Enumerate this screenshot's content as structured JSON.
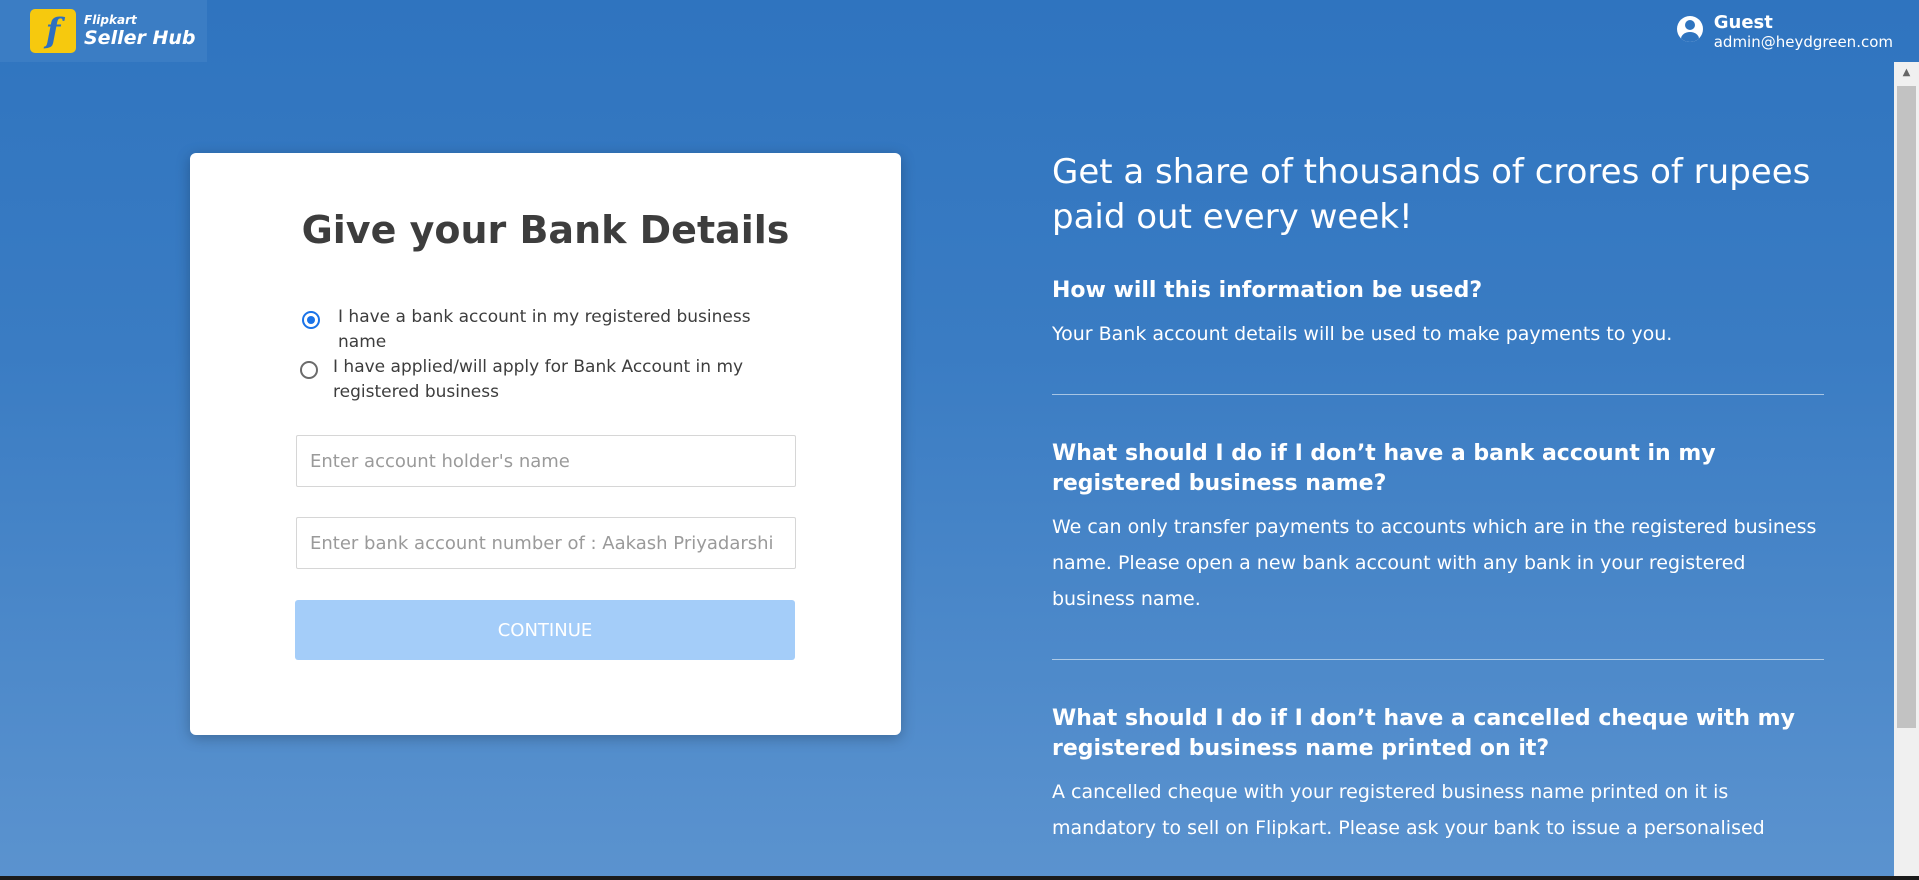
{
  "header": {
    "logo_line1": "Flipkart",
    "logo_line2": "Seller Hub",
    "logo_icon": "flipkart-f-icon",
    "user_name": "Guest",
    "user_email": "admin@heydgreen.com"
  },
  "form": {
    "title": "Give your Bank Details",
    "radio_options": [
      {
        "label": "I have a bank account in my registered business name",
        "checked": true
      },
      {
        "label": "I have applied/will apply for Bank Account in my registered business",
        "checked": false
      }
    ],
    "account_holder_placeholder": "Enter account holder's name",
    "account_number_placeholder": "Enter bank account number of : Aakash Priyadarshi",
    "continue_label": "CONTINUE"
  },
  "info": {
    "headline": "Get a share of thousands of crores of rupees paid out every week!",
    "sections": [
      {
        "question": "How will this information be used?",
        "answer": "Your Bank account details will be used to make payments to you."
      },
      {
        "question": "What should I do if I don’t have a bank account in my registered business name?",
        "answer": "We can only transfer payments to accounts which are in the registered business name. Please open a new bank account with any bank in your registered business name."
      },
      {
        "question": "What should I do if I don’t have a cancelled cheque with my registered business name printed on it?",
        "answer": "A cancelled cheque with your registered business name printed on it is mandatory to sell on Flipkart. Please ask your bank to issue a personalised"
      }
    ]
  },
  "colors": {
    "background": "#2f74bf",
    "button_disabled": "#a4cdf9",
    "radio_accent": "#1a73e8"
  }
}
